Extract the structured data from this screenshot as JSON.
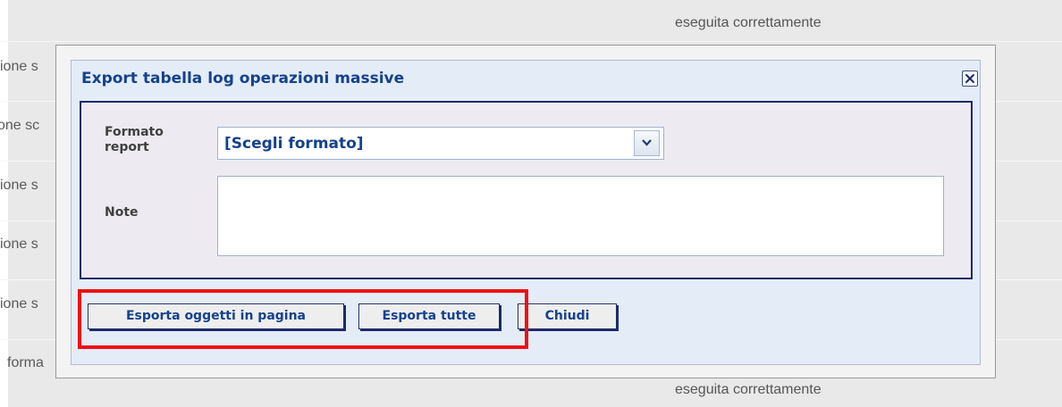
{
  "background": {
    "row_texts": [
      "ione s",
      "one sc",
      "ione s",
      "ione s",
      "ione s",
      "forma"
    ],
    "status_top": "eseguita correttamente",
    "status_bottom": "eseguita correttamente"
  },
  "dialog": {
    "title": "Export tabella log operazioni massive",
    "close_icon": "close-icon",
    "fields": {
      "format_label": "Formato report",
      "format_value": "[Scegli formato]",
      "note_label": "Note",
      "note_value": ""
    },
    "buttons": {
      "export_page": "Esporta oggetti in pagina",
      "export_all": "Esporta tutte",
      "close": "Chiudi"
    }
  },
  "colors": {
    "title_text": "#15428b",
    "panel_border": "#1e2a6b",
    "highlight": "#ee1111"
  }
}
